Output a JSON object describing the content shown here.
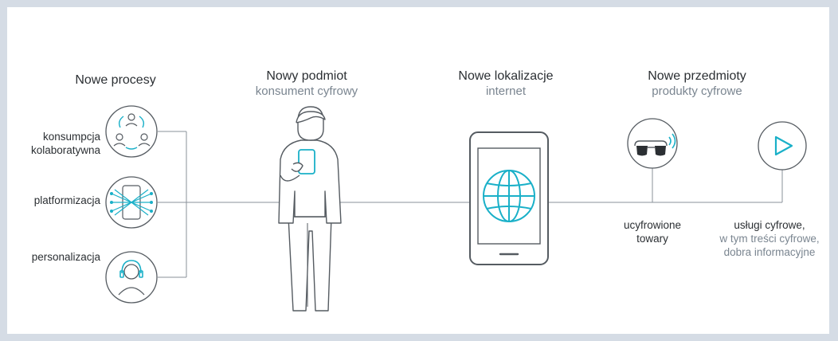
{
  "columns": {
    "processes": {
      "title": "Nowe procesy",
      "items": [
        {
          "label_line1": "konsumpcja",
          "label_line2": "kolaboratywna",
          "icon": "people-cycle-icon"
        },
        {
          "label": "platformizacja",
          "icon": "platform-network-icon"
        },
        {
          "label": "personalizacja",
          "icon": "personalization-headset-icon"
        }
      ]
    },
    "subject": {
      "title": "Nowy podmiot",
      "subtitle": "konsument cyfrowy",
      "icon": "person-with-phone-icon"
    },
    "location": {
      "title": "Nowe lokalizacje",
      "subtitle": "internet",
      "icon": "smartphone-globe-icon"
    },
    "objects": {
      "title": "Nowe przedmioty",
      "subtitle": "produkty cyfrowe",
      "items": [
        {
          "label_line1": "ucyfrowione",
          "label_line2": "towary",
          "icon": "smart-glasses-icon"
        },
        {
          "label_line1": "usługi cyfrowe,",
          "label_line2": "w tym treści cyfrowe,",
          "label_line3": "dobra informacyjne",
          "icon": "play-icon"
        }
      ]
    }
  },
  "colors": {
    "accent": "#1ab0c8",
    "line": "#8a9199",
    "outline": "#555b61",
    "background": "#d5dce5"
  }
}
